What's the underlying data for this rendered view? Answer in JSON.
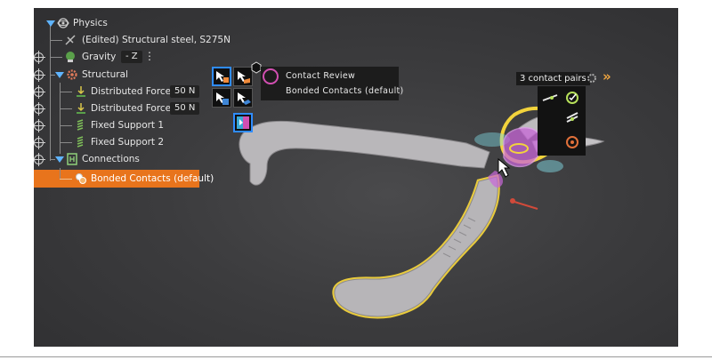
{
  "colors": {
    "viewport_bg": "#3c3c3e",
    "selection": "#e8741c",
    "highlight_yellow": "#f0d23a",
    "contact_magenta": "#c866d8",
    "contact_cyan": "#7fd6e0",
    "model_gray": "#b8b6b8"
  },
  "tree": {
    "root_label": "Physics",
    "material_label": "(Edited) Structural steel, S275N",
    "gravity": {
      "label": "Gravity",
      "value": "- Z",
      "more_icon": "vertical-dots-icon"
    },
    "structural_label": "Structural",
    "items": [
      {
        "label": "Distributed Force 1",
        "value": "50 N"
      },
      {
        "label": "Distributed Force 2",
        "value": "50 N"
      },
      {
        "label": "Fixed Support 1"
      },
      {
        "label": "Fixed Support 2"
      }
    ],
    "connections_label": "Connections",
    "bonded_label": "Bonded Contacts (default)"
  },
  "context_menu": {
    "items": [
      {
        "label": "Contact Review"
      },
      {
        "label": "Bonded Contacts (default)"
      }
    ]
  },
  "contact_pairs": {
    "label": "3 contact pairs",
    "icons": [
      "settings-icon",
      "forward-icon",
      "pair-align-icon",
      "pair-check-icon",
      "pair-slide-icon",
      "pair-target-icon"
    ]
  }
}
